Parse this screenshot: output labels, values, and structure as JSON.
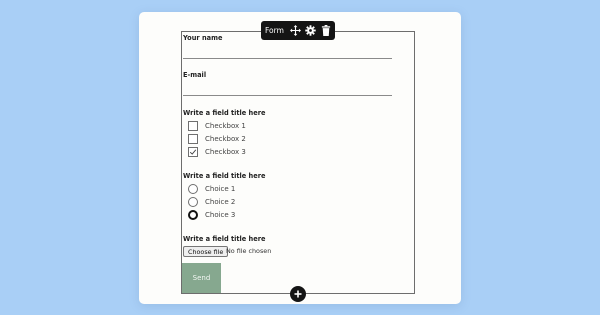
{
  "toolbar": {
    "label": "Form",
    "move_icon": "move-icon",
    "settings_icon": "gear-icon",
    "delete_icon": "trash-icon"
  },
  "form": {
    "name_label": "Your name",
    "name_value": "",
    "email_label": "E-mail",
    "email_value": "",
    "checkbox_group": {
      "title": "Write a field title here",
      "items": [
        {
          "label": "Checkbox 1",
          "checked": false
        },
        {
          "label": "Checkbox 2",
          "checked": false
        },
        {
          "label": "Checkbox 3",
          "checked": true
        }
      ]
    },
    "radio_group": {
      "title": "Write a field title here",
      "items": [
        {
          "label": "Choice 1",
          "selected": false
        },
        {
          "label": "Choice 2",
          "selected": false
        },
        {
          "label": "Choice 3",
          "selected": true
        }
      ]
    },
    "file_group": {
      "title": "Write a field title here",
      "button_label": "Choose file",
      "status": "No file chosen"
    },
    "submit_label": "Send"
  },
  "add_icon": "plus-icon",
  "colors": {
    "background": "#a9cff6",
    "card": "#fdfdfb",
    "toolbar": "#141414",
    "send_button": "#86a88f"
  }
}
